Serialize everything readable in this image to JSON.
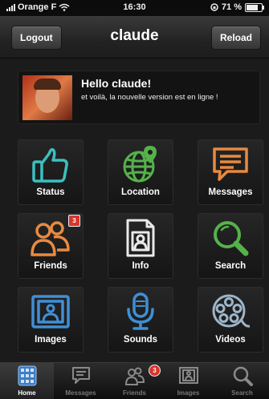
{
  "status_bar": {
    "carrier": "Orange F",
    "time": "16:30",
    "battery": "71 %"
  },
  "nav": {
    "logout_label": "Logout",
    "title": "claude",
    "reload_label": "Reload"
  },
  "welcome": {
    "greeting": "Hello claude!",
    "message": "et voilà, la nouvelle version est en ligne !"
  },
  "grid": [
    {
      "label": "Status",
      "icon": "thumbs-up-icon"
    },
    {
      "label": "Location",
      "icon": "globe-pin-icon"
    },
    {
      "label": "Messages",
      "icon": "message-bubble-icon"
    },
    {
      "label": "Friends",
      "icon": "friends-icon",
      "badge": "3"
    },
    {
      "label": "Info",
      "icon": "id-document-icon"
    },
    {
      "label": "Search",
      "icon": "magnifier-icon"
    },
    {
      "label": "Images",
      "icon": "picture-frame-icon"
    },
    {
      "label": "Sounds",
      "icon": "microphone-icon"
    },
    {
      "label": "Videos",
      "icon": "film-reel-icon"
    }
  ],
  "tabs": [
    {
      "label": "Home",
      "icon": "home-grid-icon",
      "active": true
    },
    {
      "label": "Messages",
      "icon": "message-bubble-icon"
    },
    {
      "label": "Friends",
      "icon": "friends-icon",
      "badge": "3"
    },
    {
      "label": "Images",
      "icon": "picture-frame-icon"
    },
    {
      "label": "Search",
      "icon": "magnifier-icon"
    }
  ],
  "colors": {
    "status": "#3cbfc0",
    "location": "#55b24a",
    "messages": "#e88a40",
    "friends": "#e88a40",
    "info": "#e9e9e9",
    "search": "#55b24a",
    "images": "#3f8fd6",
    "sounds": "#3f8fd6",
    "videos": "#9db5c9",
    "badge": "#d8352b"
  }
}
